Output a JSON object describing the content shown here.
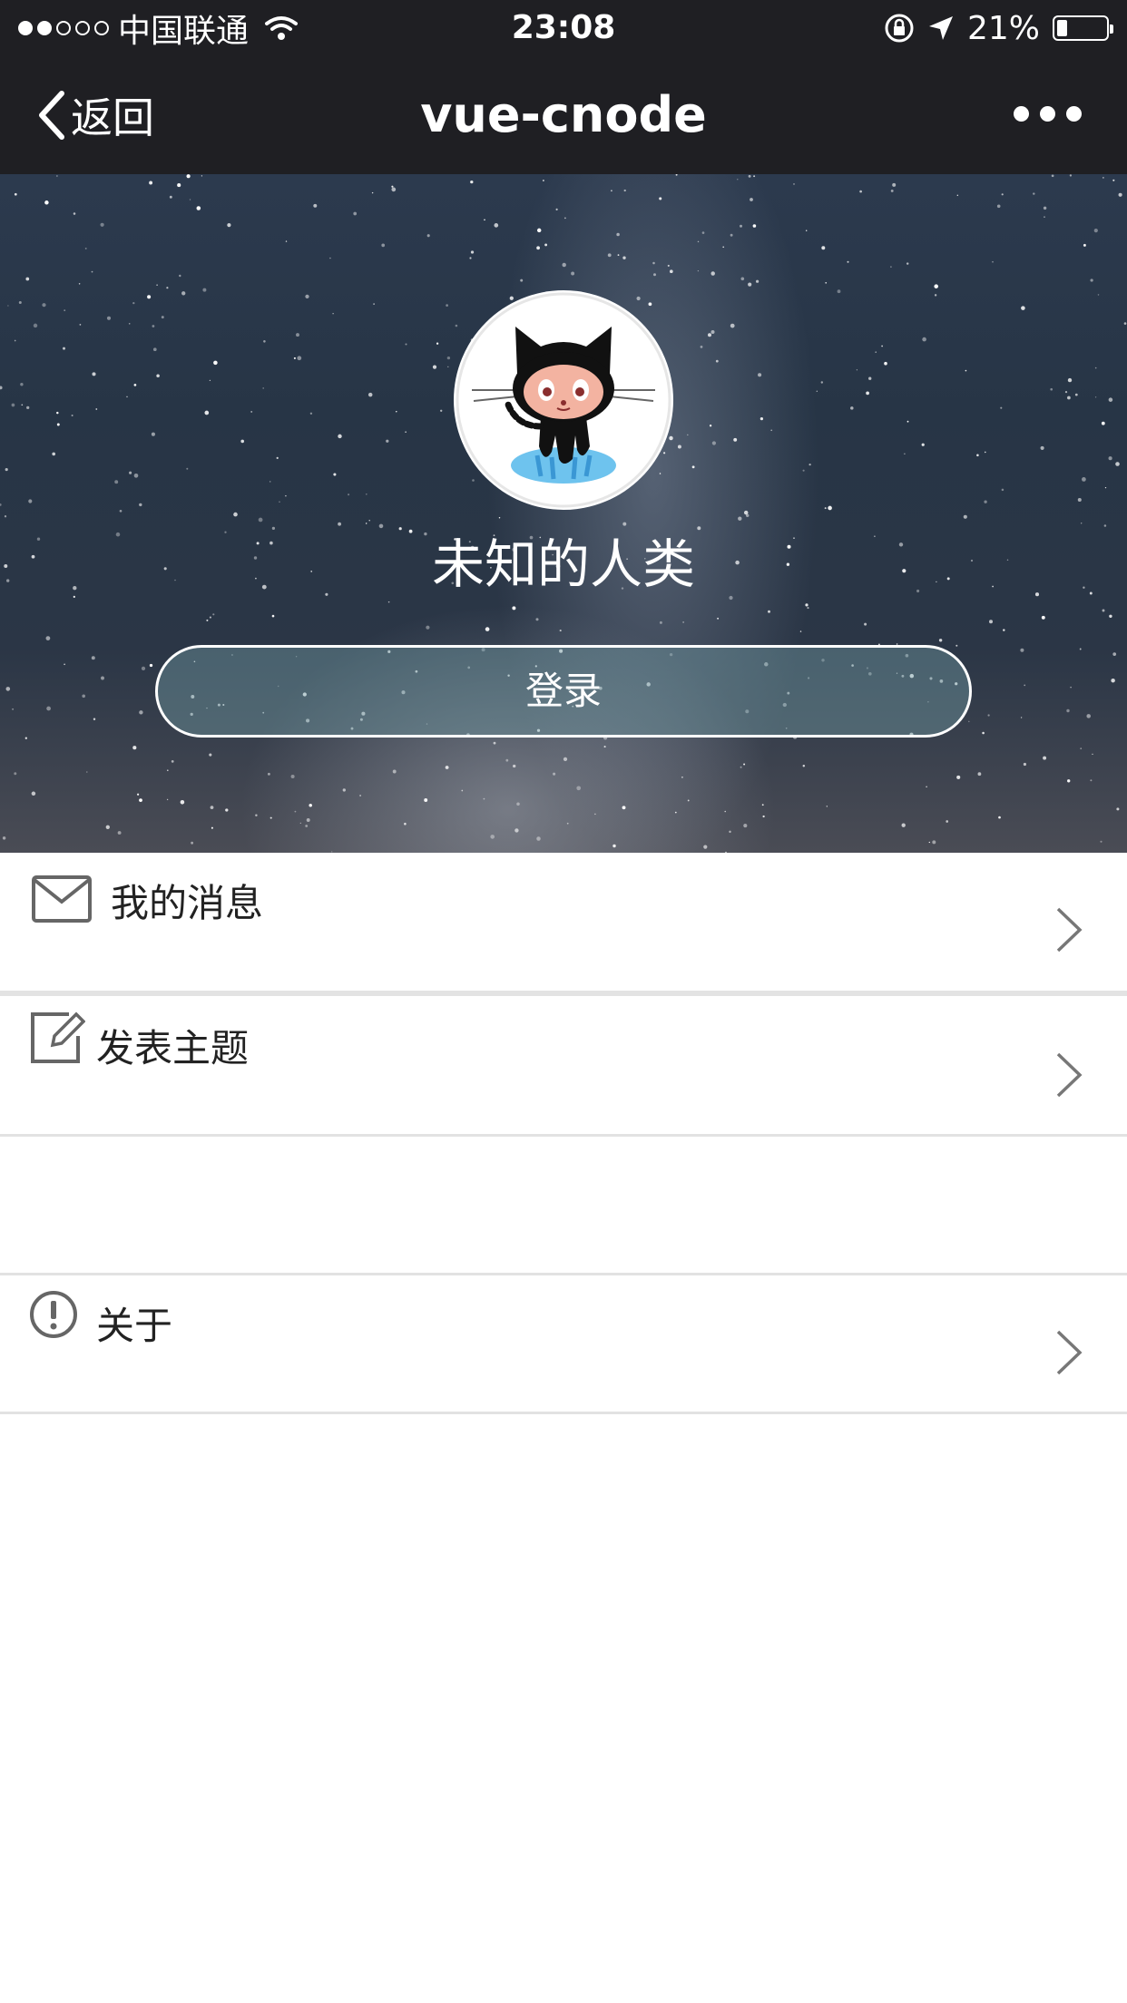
{
  "status_bar": {
    "carrier": "中国联通",
    "time": "23:08",
    "battery_text": "21%",
    "battery_level": 0.21
  },
  "nav": {
    "back_label": "返回",
    "title": "vue-cnode"
  },
  "profile": {
    "user_name": "未知的人类",
    "login_label": "登录",
    "avatar_icon": "octocat-avatar"
  },
  "menu": {
    "items": [
      {
        "label": "我的消息",
        "icon": "mail-icon"
      },
      {
        "label": "发表主题",
        "icon": "edit-icon"
      },
      {
        "label": "关于",
        "icon": "info-icon"
      }
    ]
  },
  "colors": {
    "bar_background": "#1f1f23",
    "divider": "#e2e2e2"
  }
}
